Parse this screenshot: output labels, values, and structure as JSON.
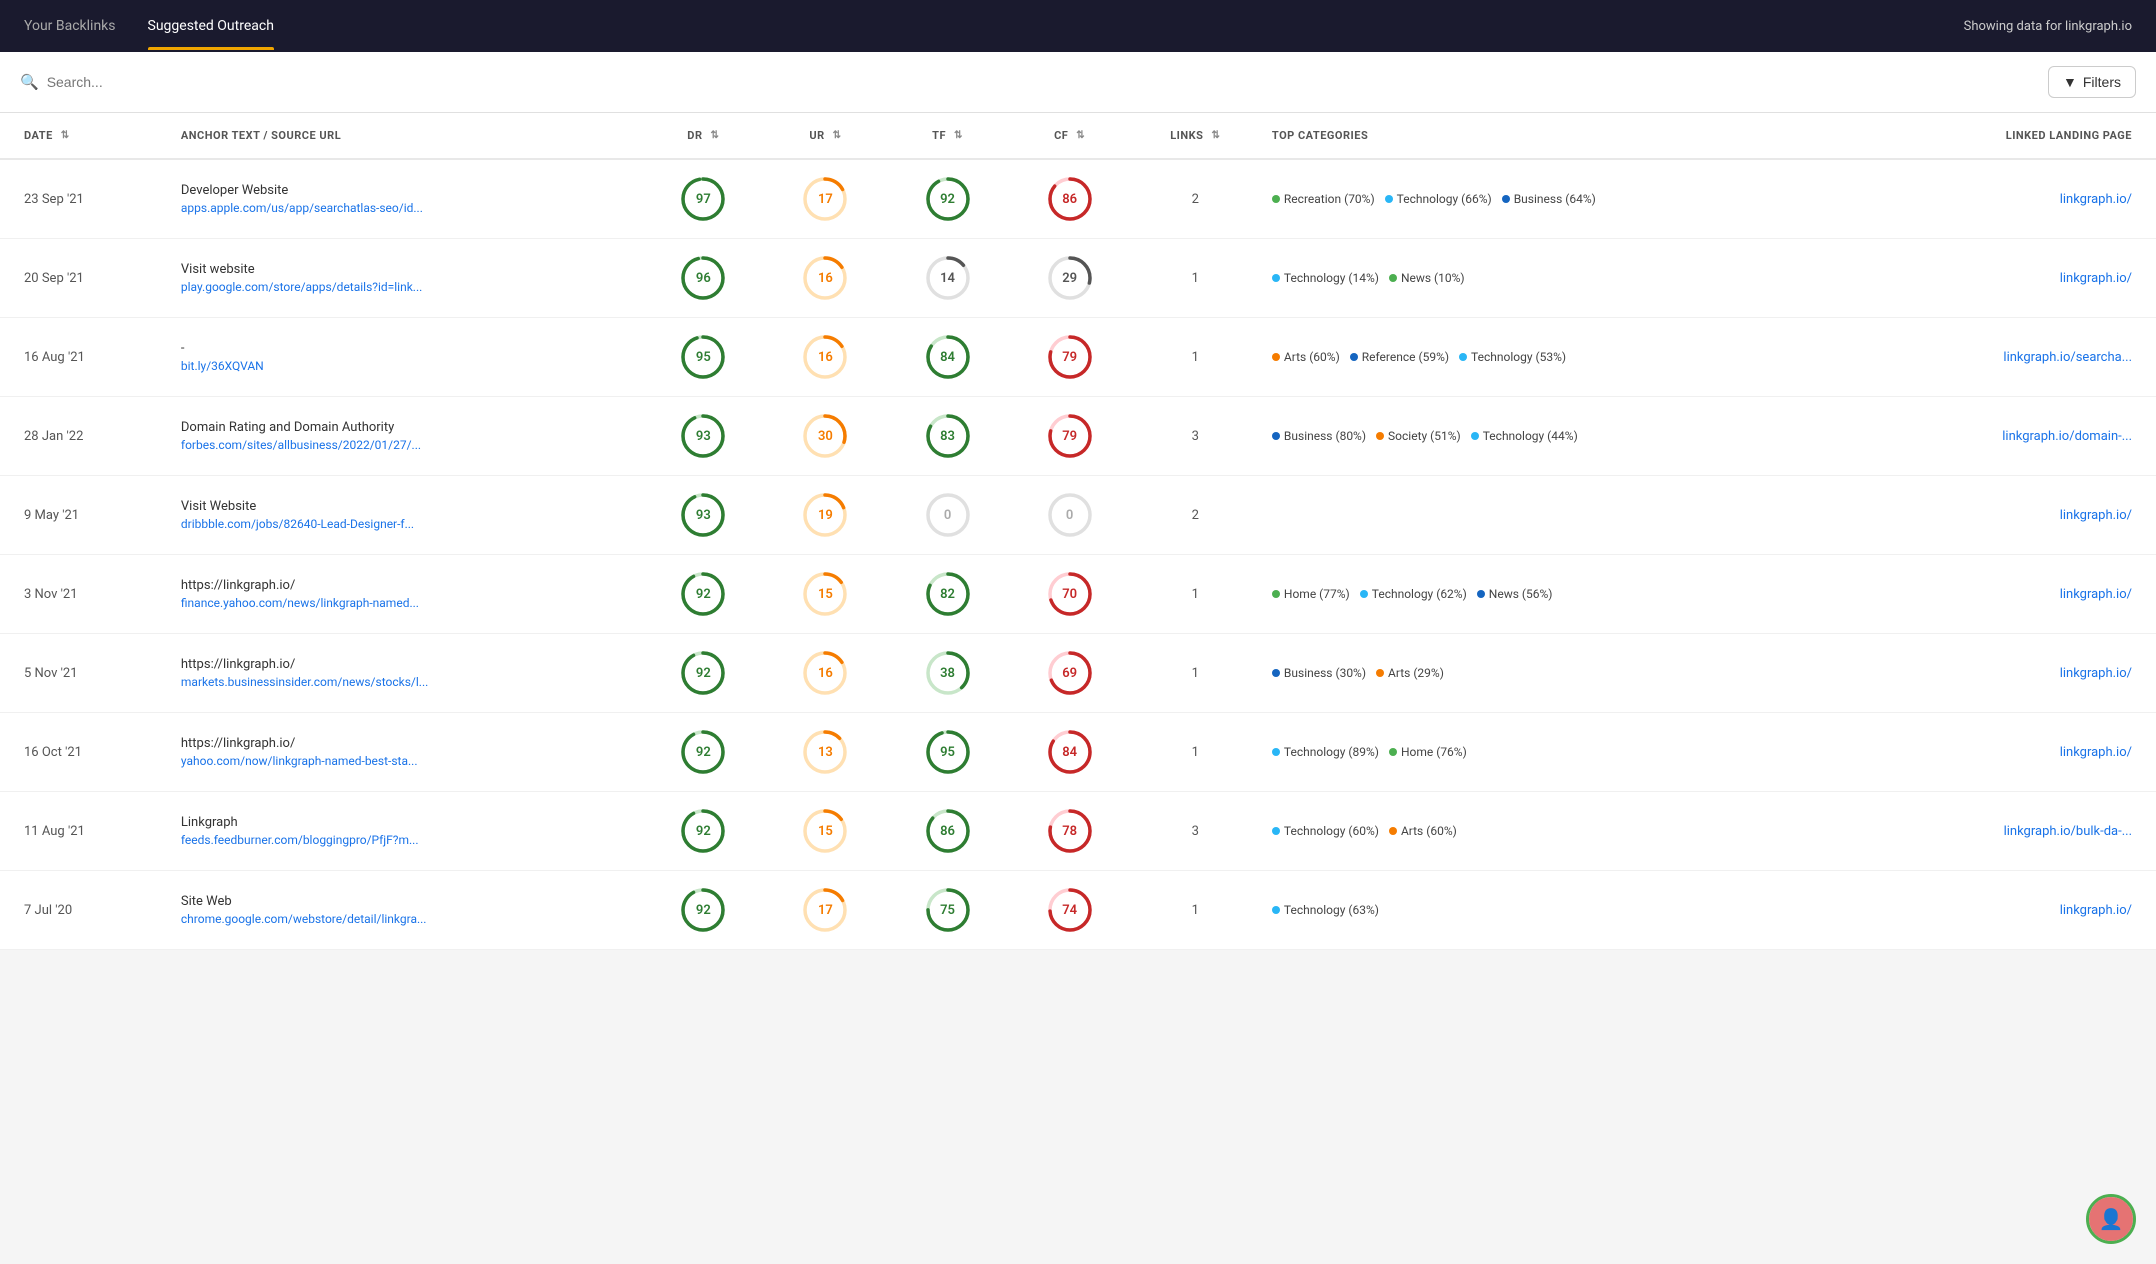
{
  "nav": {
    "items": [
      {
        "label": "Your Backlinks",
        "active": false
      },
      {
        "label": "Suggested Outreach",
        "active": true
      }
    ],
    "right_text": "Showing data for linkgraph.io"
  },
  "search": {
    "placeholder": "Search...",
    "filters_label": "Filters"
  },
  "table": {
    "columns": [
      {
        "key": "date",
        "label": "DATE",
        "sortable": true,
        "align": "left"
      },
      {
        "key": "anchor",
        "label": "ANCHOR TEXT / SOURCE URL",
        "sortable": false,
        "align": "left"
      },
      {
        "key": "dr",
        "label": "DR",
        "sortable": true,
        "align": "center"
      },
      {
        "key": "ur",
        "label": "UR",
        "sortable": true,
        "align": "center"
      },
      {
        "key": "tf",
        "label": "TF",
        "sortable": true,
        "align": "center"
      },
      {
        "key": "cf",
        "label": "CF",
        "sortable": true,
        "align": "center"
      },
      {
        "key": "links",
        "label": "LINKS",
        "sortable": true,
        "align": "center"
      },
      {
        "key": "categories",
        "label": "TOP CATEGORIES",
        "sortable": false,
        "align": "left"
      },
      {
        "key": "landing",
        "label": "LINKED LANDING PAGE",
        "sortable": false,
        "align": "right"
      }
    ],
    "rows": [
      {
        "date": "23 Sep '21",
        "anchor_title": "Developer Website",
        "anchor_url": "apps.apple.com/us/app/searchatlas-seo/id...",
        "dr": 97,
        "dr_color": "#2e7d32",
        "dr_track": "#c8e6c9",
        "ur": 17,
        "ur_color": "#f57c00",
        "ur_track": "#ffe0b2",
        "tf": 92,
        "tf_color": "#2e7d32",
        "tf_track": "#c8e6c9",
        "cf": 86,
        "cf_color": "#c62828",
        "cf_track": "#ffcdd2",
        "links": 2,
        "categories": [
          {
            "label": "Recreation (70%)",
            "color": "#4caf50"
          },
          {
            "label": "Technology (66%)",
            "color": "#29b6f6"
          },
          {
            "label": "Business (64%)",
            "color": "#1565c0"
          }
        ],
        "landing": "linkgraph.io/"
      },
      {
        "date": "20 Sep '21",
        "anchor_title": "Visit website",
        "anchor_url": "play.google.com/store/apps/details?id=link...",
        "dr": 96,
        "dr_color": "#2e7d32",
        "dr_track": "#c8e6c9",
        "ur": 16,
        "ur_color": "#f57c00",
        "ur_track": "#ffe0b2",
        "tf": 14,
        "tf_color": "#555",
        "tf_track": "#e0e0e0",
        "cf": 29,
        "cf_color": "#555",
        "cf_track": "#e0e0e0",
        "links": 1,
        "categories": [
          {
            "label": "Technology (14%)",
            "color": "#29b6f6"
          },
          {
            "label": "News (10%)",
            "color": "#4caf50"
          }
        ],
        "landing": "linkgraph.io/"
      },
      {
        "date": "16 Aug '21",
        "anchor_title": "-",
        "anchor_url": "bit.ly/36XQVAN",
        "dr": 95,
        "dr_color": "#2e7d32",
        "dr_track": "#c8e6c9",
        "ur": 16,
        "ur_color": "#f57c00",
        "ur_track": "#ffe0b2",
        "tf": 84,
        "tf_color": "#2e7d32",
        "tf_track": "#c8e6c9",
        "cf": 79,
        "cf_color": "#c62828",
        "cf_track": "#ffcdd2",
        "links": 1,
        "categories": [
          {
            "label": "Arts (60%)",
            "color": "#f57c00"
          },
          {
            "label": "Reference (59%)",
            "color": "#1565c0"
          },
          {
            "label": "Technology (53%)",
            "color": "#29b6f6"
          }
        ],
        "landing": "linkgraph.io/searcha..."
      },
      {
        "date": "28 Jan '22",
        "anchor_title": "Domain Rating and Domain Authority",
        "anchor_url": "forbes.com/sites/allbusiness/2022/01/27/...",
        "dr": 93,
        "dr_color": "#2e7d32",
        "dr_track": "#c8e6c9",
        "ur": 30,
        "ur_color": "#f57c00",
        "ur_track": "#ffe0b2",
        "tf": 83,
        "tf_color": "#2e7d32",
        "tf_track": "#c8e6c9",
        "cf": 79,
        "cf_color": "#c62828",
        "cf_track": "#ffcdd2",
        "links": 3,
        "categories": [
          {
            "label": "Business (80%)",
            "color": "#1565c0"
          },
          {
            "label": "Society (51%)",
            "color": "#f57c00"
          },
          {
            "label": "Technology (44%)",
            "color": "#29b6f6"
          }
        ],
        "landing": "linkgraph.io/domain-..."
      },
      {
        "date": "9 May '21",
        "anchor_title": "Visit Website",
        "anchor_url": "dribbble.com/jobs/82640-Lead-Designer-f...",
        "dr": 93,
        "dr_color": "#2e7d32",
        "dr_track": "#c8e6c9",
        "ur": 19,
        "ur_color": "#f57c00",
        "ur_track": "#ffe0b2",
        "tf": 0,
        "tf_color": "#aaa",
        "tf_track": "#e0e0e0",
        "cf": 0,
        "cf_color": "#aaa",
        "cf_track": "#e0e0e0",
        "links": 2,
        "categories": [],
        "landing": "linkgraph.io/"
      },
      {
        "date": "3 Nov '21",
        "anchor_title": "https://linkgraph.io/",
        "anchor_url": "finance.yahoo.com/news/linkgraph-named...",
        "dr": 92,
        "dr_color": "#2e7d32",
        "dr_track": "#c8e6c9",
        "ur": 15,
        "ur_color": "#f57c00",
        "ur_track": "#ffe0b2",
        "tf": 82,
        "tf_color": "#2e7d32",
        "tf_track": "#c8e6c9",
        "cf": 70,
        "cf_color": "#c62828",
        "cf_track": "#ffcdd2",
        "links": 1,
        "categories": [
          {
            "label": "Home (77%)",
            "color": "#4caf50"
          },
          {
            "label": "Technology (62%)",
            "color": "#29b6f6"
          },
          {
            "label": "News (56%)",
            "color": "#1565c0"
          }
        ],
        "landing": "linkgraph.io/"
      },
      {
        "date": "5 Nov '21",
        "anchor_title": "https://linkgraph.io/",
        "anchor_url": "markets.businessinsider.com/news/stocks/l...",
        "dr": 92,
        "dr_color": "#2e7d32",
        "dr_track": "#c8e6c9",
        "ur": 16,
        "ur_color": "#f57c00",
        "ur_track": "#ffe0b2",
        "tf": 38,
        "tf_color": "#2e7d32",
        "tf_track": "#c8e6c9",
        "cf": 69,
        "cf_color": "#c62828",
        "cf_track": "#ffcdd2",
        "links": 1,
        "categories": [
          {
            "label": "Business (30%)",
            "color": "#1565c0"
          },
          {
            "label": "Arts (29%)",
            "color": "#f57c00"
          }
        ],
        "landing": "linkgraph.io/"
      },
      {
        "date": "16 Oct '21",
        "anchor_title": "https://linkgraph.io/",
        "anchor_url": "yahoo.com/now/linkgraph-named-best-sta...",
        "dr": 92,
        "dr_color": "#2e7d32",
        "dr_track": "#c8e6c9",
        "ur": 13,
        "ur_color": "#f57c00",
        "ur_track": "#ffe0b2",
        "tf": 95,
        "tf_color": "#2e7d32",
        "tf_track": "#c8e6c9",
        "cf": 84,
        "cf_color": "#c62828",
        "cf_track": "#ffcdd2",
        "links": 1,
        "categories": [
          {
            "label": "Technology (89%)",
            "color": "#29b6f6"
          },
          {
            "label": "Home (76%)",
            "color": "#4caf50"
          }
        ],
        "landing": "linkgraph.io/"
      },
      {
        "date": "11 Aug '21",
        "anchor_title": "Linkgraph",
        "anchor_url": "feeds.feedburner.com/bloggingpro/PfjF?m...",
        "dr": 92,
        "dr_color": "#2e7d32",
        "dr_track": "#c8e6c9",
        "ur": 15,
        "ur_color": "#f57c00",
        "ur_track": "#ffe0b2",
        "tf": 86,
        "tf_color": "#2e7d32",
        "tf_track": "#c8e6c9",
        "cf": 78,
        "cf_color": "#c62828",
        "cf_track": "#ffcdd2",
        "links": 3,
        "categories": [
          {
            "label": "Technology (60%)",
            "color": "#29b6f6"
          },
          {
            "label": "Arts (60%)",
            "color": "#f57c00"
          }
        ],
        "landing": "linkgraph.io/bulk-da-..."
      },
      {
        "date": "7 Jul '20",
        "anchor_title": "Site Web",
        "anchor_url": "chrome.google.com/webstore/detail/linkgra...",
        "dr": 92,
        "dr_color": "#2e7d32",
        "dr_track": "#c8e6c9",
        "ur": 17,
        "ur_color": "#f57c00",
        "ur_track": "#ffe0b2",
        "tf": 75,
        "tf_color": "#2e7d32",
        "tf_track": "#c8e6c9",
        "cf": 74,
        "cf_color": "#c62828",
        "cf_track": "#ffcdd2",
        "links": 1,
        "categories": [
          {
            "label": "Technology (63%)",
            "color": "#29b6f6"
          }
        ],
        "landing": "linkgraph.io/"
      }
    ]
  }
}
